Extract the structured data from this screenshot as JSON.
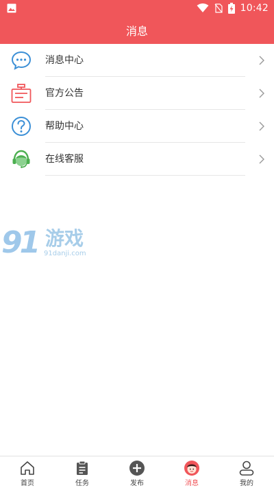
{
  "status_bar": {
    "time": "10:42",
    "icons": [
      "gallery-icon",
      "wifi-icon",
      "no-sim-icon",
      "battery-charging-icon"
    ]
  },
  "header": {
    "title": "消息"
  },
  "menu": {
    "items": [
      {
        "label": "消息中心",
        "icon": "chat-bubble-icon"
      },
      {
        "label": "官方公告",
        "icon": "announcement-icon"
      },
      {
        "label": "帮助中心",
        "icon": "help-icon"
      },
      {
        "label": "在线客服",
        "icon": "customer-service-icon"
      }
    ]
  },
  "watermark": {
    "number": "91",
    "text": "游戏",
    "url": "91danji.com"
  },
  "tabs": [
    {
      "label": "首页",
      "icon": "home-icon",
      "active": false
    },
    {
      "label": "任务",
      "icon": "clipboard-icon",
      "active": false
    },
    {
      "label": "发布",
      "icon": "plus-circle-icon",
      "active": false
    },
    {
      "label": "消息",
      "icon": "message-avatar-icon",
      "active": true
    },
    {
      "label": "我的",
      "icon": "user-icon",
      "active": false
    }
  ],
  "colors": {
    "brand": "#f0565a",
    "accent_blue": "#3b8fd6",
    "accent_green": "#4caf50",
    "watermark": "#a7cde9",
    "divider": "#e6e6e6"
  }
}
